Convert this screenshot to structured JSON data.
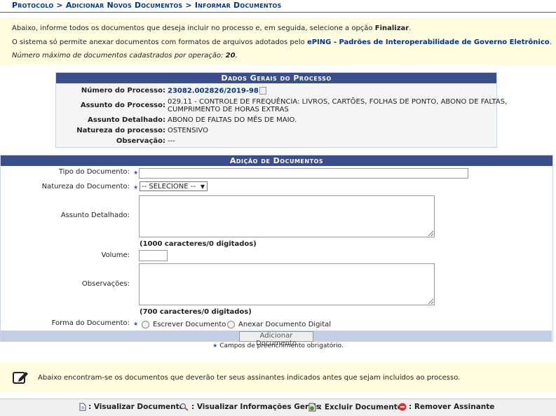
{
  "breadcrumb": "Protocolo > Adicionar Novos Documentos > Informar Documentos",
  "info": {
    "line1_prefix": "Abaixo, informe todos os documentos que deseja incluir no processo e, em seguida, selecione a opção ",
    "line1_bold": "Finalizar",
    "line1_suffix": ".",
    "line2_prefix": "O sistema só permite anexar documentos com formatos de arquivos adotados pelo ",
    "line2_link": "ePING - Padrões de Interoperabilidade de Governo Eletrônico",
    "line2_suffix": ".",
    "line3_prefix": "Número máximo de documentos cadastrados por operação: ",
    "line3_value": "20",
    "line3_suffix": "."
  },
  "dados": {
    "title": "Dados Gerais do Processo",
    "numero_label": "Número do Processo:",
    "numero_value": "23082.002826/2019-98",
    "assunto_label": "Assunto do Processo:",
    "assunto_value_1": "029.11 - CONTROLE DE FREQUÊNCIA: LIVROS, CARTÕES, FOLHAS DE PONTO, ABONO DE FALTAS,",
    "assunto_value_2": "CUMPRIMENTO DE HORAS EXTRAS",
    "detalhado_label": "Assunto Detalhado:",
    "detalhado_value": "ABONO DE FALTAS DO MÊS DE MAIO.",
    "natureza_label": "Natureza do processo:",
    "natureza_value": "OSTENSIVO",
    "obs_label": "Observação:",
    "obs_value": "---"
  },
  "adicao": {
    "title": "Adição de Documentos",
    "tipo_label": "Tipo do Documento:",
    "natureza_label": "Natureza do Documento:",
    "natureza_selected": "-- SELECIONE --",
    "assunto_label": "Assunto Detalhado:",
    "assunto_hint": "(1000 caracteres/0 digitados)",
    "volume_label": "Volume:",
    "obs_label": "Observações:",
    "obs_hint": "(700 caracteres/0 digitados)",
    "forma_label": "Forma do Documento:",
    "forma_opt1": "Escrever Documento",
    "forma_opt2": "Anexar Documento Digital",
    "add_button": "Adicionar Documento",
    "required_note": "Campos de preenchimento obrigatório.",
    "star": "★"
  },
  "notice": "Abaixo encontram-se os documentos que deverão ter seus assinantes indicados antes que sejam incluídos ao processo.",
  "legend": {
    "view_doc": ": Visualizar Documento",
    "view_info": ": Visualizar Informações Gerais",
    "delete_doc": ": Excluir Documento",
    "remove_signer": ": Remover Assinante"
  }
}
